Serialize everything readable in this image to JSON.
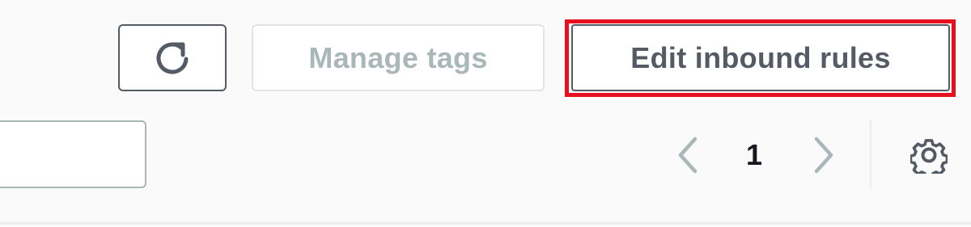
{
  "toolbar": {
    "refresh_icon": "refresh-icon",
    "manage_tags_label": "Manage tags",
    "manage_tags_disabled": true,
    "edit_inbound_label": "Edit inbound rules",
    "highlight_color": "#e8101e"
  },
  "filter": {
    "search_value": "",
    "search_placeholder": ""
  },
  "pagination": {
    "prev_icon": "chevron-left-icon",
    "current_page": "1",
    "next_icon": "chevron-right-icon"
  },
  "preferences": {
    "icon": "gear-icon"
  },
  "colors": {
    "page_background": "#fafafa",
    "button_text": "#545b64",
    "disabled_text": "#aab7b8",
    "active_text": "#16191f"
  }
}
